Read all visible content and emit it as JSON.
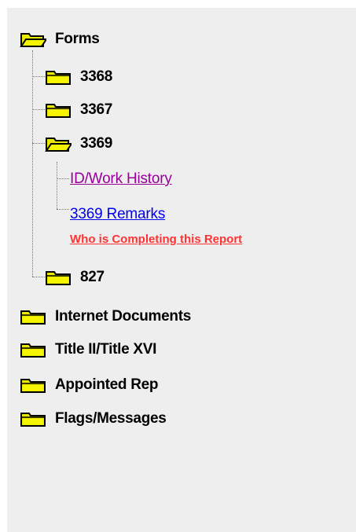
{
  "tree": {
    "forms": {
      "label": "Forms",
      "expanded": true,
      "children": [
        {
          "label": "3368",
          "expanded": false
        },
        {
          "label": "3367",
          "expanded": false
        },
        {
          "label": "3369",
          "expanded": true,
          "links": [
            {
              "label": "ID/Work History",
              "state": "visited"
            },
            {
              "label": "3369 Remarks",
              "state": "unvisited",
              "sublink": "Who is Completing this Report"
            }
          ]
        },
        {
          "label": "827",
          "expanded": false
        }
      ]
    },
    "top_folders": [
      {
        "label": "Internet Documents"
      },
      {
        "label": "Title II/Title XVI"
      },
      {
        "label": "Appointed Rep"
      },
      {
        "label": "Flags/Messages"
      }
    ]
  },
  "colors": {
    "panel_bg": "#eeeeee",
    "folder_fill": "#f0f000",
    "visited_link": "#990099",
    "unvisited_link": "#0000ee",
    "alert_link": "#ff3333"
  },
  "icons": {
    "open_folder": "open-folder-icon",
    "closed_folder": "closed-folder-icon"
  }
}
